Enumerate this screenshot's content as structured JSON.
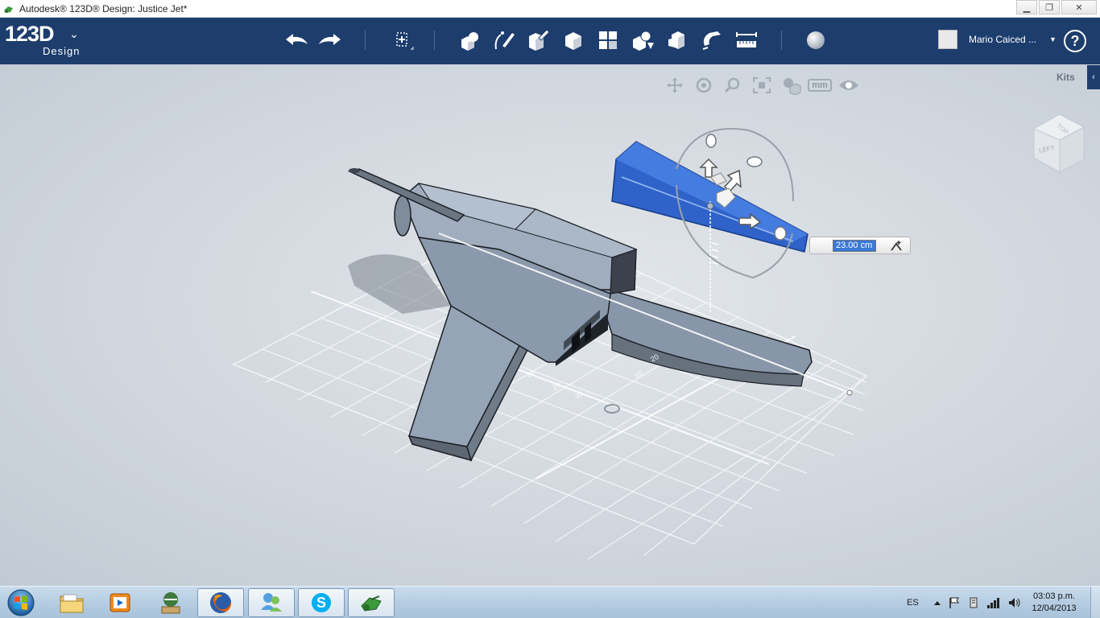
{
  "window": {
    "title": "Autodesk® 123D® Design: Justice Jet*",
    "controls": [
      "minimize-icon",
      "restore-icon",
      "close-icon"
    ],
    "close_glyph": "✕",
    "minimize_glyph": "▁",
    "restore_glyph": "❐"
  },
  "app": {
    "logo_text": "123D",
    "logo_sub": "Design",
    "logo_chevron": "⌄"
  },
  "toolbar": {
    "tools": [
      "undo-icon",
      "redo-icon",
      "transform-icon",
      "primitives-icon",
      "sketch-icon",
      "construct-icon",
      "modify-icon",
      "pattern-icon",
      "grouping-icon",
      "combine-icon",
      "snap-icon",
      "measure-icon",
      "material-icon"
    ]
  },
  "user": {
    "name": "Mario Caiced ...",
    "caret": "▼"
  },
  "help": {
    "label": "?"
  },
  "viewport": {
    "kits_label": "Kits",
    "kits_arrow": "‹",
    "nav_tools": [
      "pan-icon",
      "orbit-icon",
      "zoom-icon",
      "fit-icon",
      "view-style-icon",
      "units-icon",
      "visibility-icon"
    ],
    "units_label": "mm",
    "viewcube_labels": {
      "top": "TOP",
      "left": "LEFT"
    },
    "dimension_value": "23.00 cm",
    "grid_labels": [
      "10",
      "20",
      "10",
      "20",
      "30"
    ]
  },
  "colors": {
    "toolbar_bg": "#1d3d6d",
    "selection_blue": "#2f63c9",
    "model_gray": "#8c9aab"
  },
  "taskbar": {
    "apps": [
      "windows-start-icon",
      "file-explorer-icon",
      "media-player-icon",
      "media-center-icon",
      "firefox-icon",
      "messenger-icon",
      "skype-icon",
      "123d-design-icon"
    ],
    "language": "ES",
    "time": "03:03 p.m.",
    "date": "12/04/2013"
  }
}
